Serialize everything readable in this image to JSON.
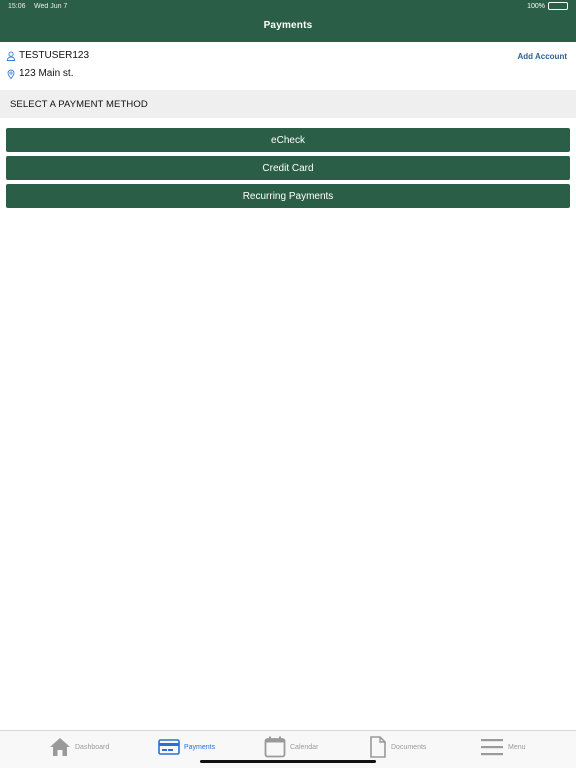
{
  "status_bar": {
    "time": "15:06",
    "date": "Wed Jun 7",
    "battery": "100%"
  },
  "header": {
    "title": "Payments"
  },
  "account": {
    "user": "TESTUSER123",
    "address": "123 Main st.",
    "add_account_label": "Add Account"
  },
  "section": {
    "title": "SELECT A PAYMENT METHOD"
  },
  "payment_methods": [
    {
      "label": "eCheck"
    },
    {
      "label": "Credit Card"
    },
    {
      "label": "Recurring Payments"
    }
  ],
  "tabbar": {
    "items": [
      {
        "label": "Dashboard",
        "icon": "home-icon",
        "active": false
      },
      {
        "label": "Payments",
        "icon": "credit-card-icon",
        "active": true
      },
      {
        "label": "Calendar",
        "icon": "calendar-icon",
        "active": false
      },
      {
        "label": "Documents",
        "icon": "document-icon",
        "active": false
      },
      {
        "label": "Menu",
        "icon": "menu-icon",
        "active": false
      }
    ]
  },
  "colors": {
    "brand_green": "#2a5e47",
    "active_tab": "#2b6fd6",
    "link_blue": "#2a6496",
    "inactive_tab": "#9a9a9a"
  }
}
